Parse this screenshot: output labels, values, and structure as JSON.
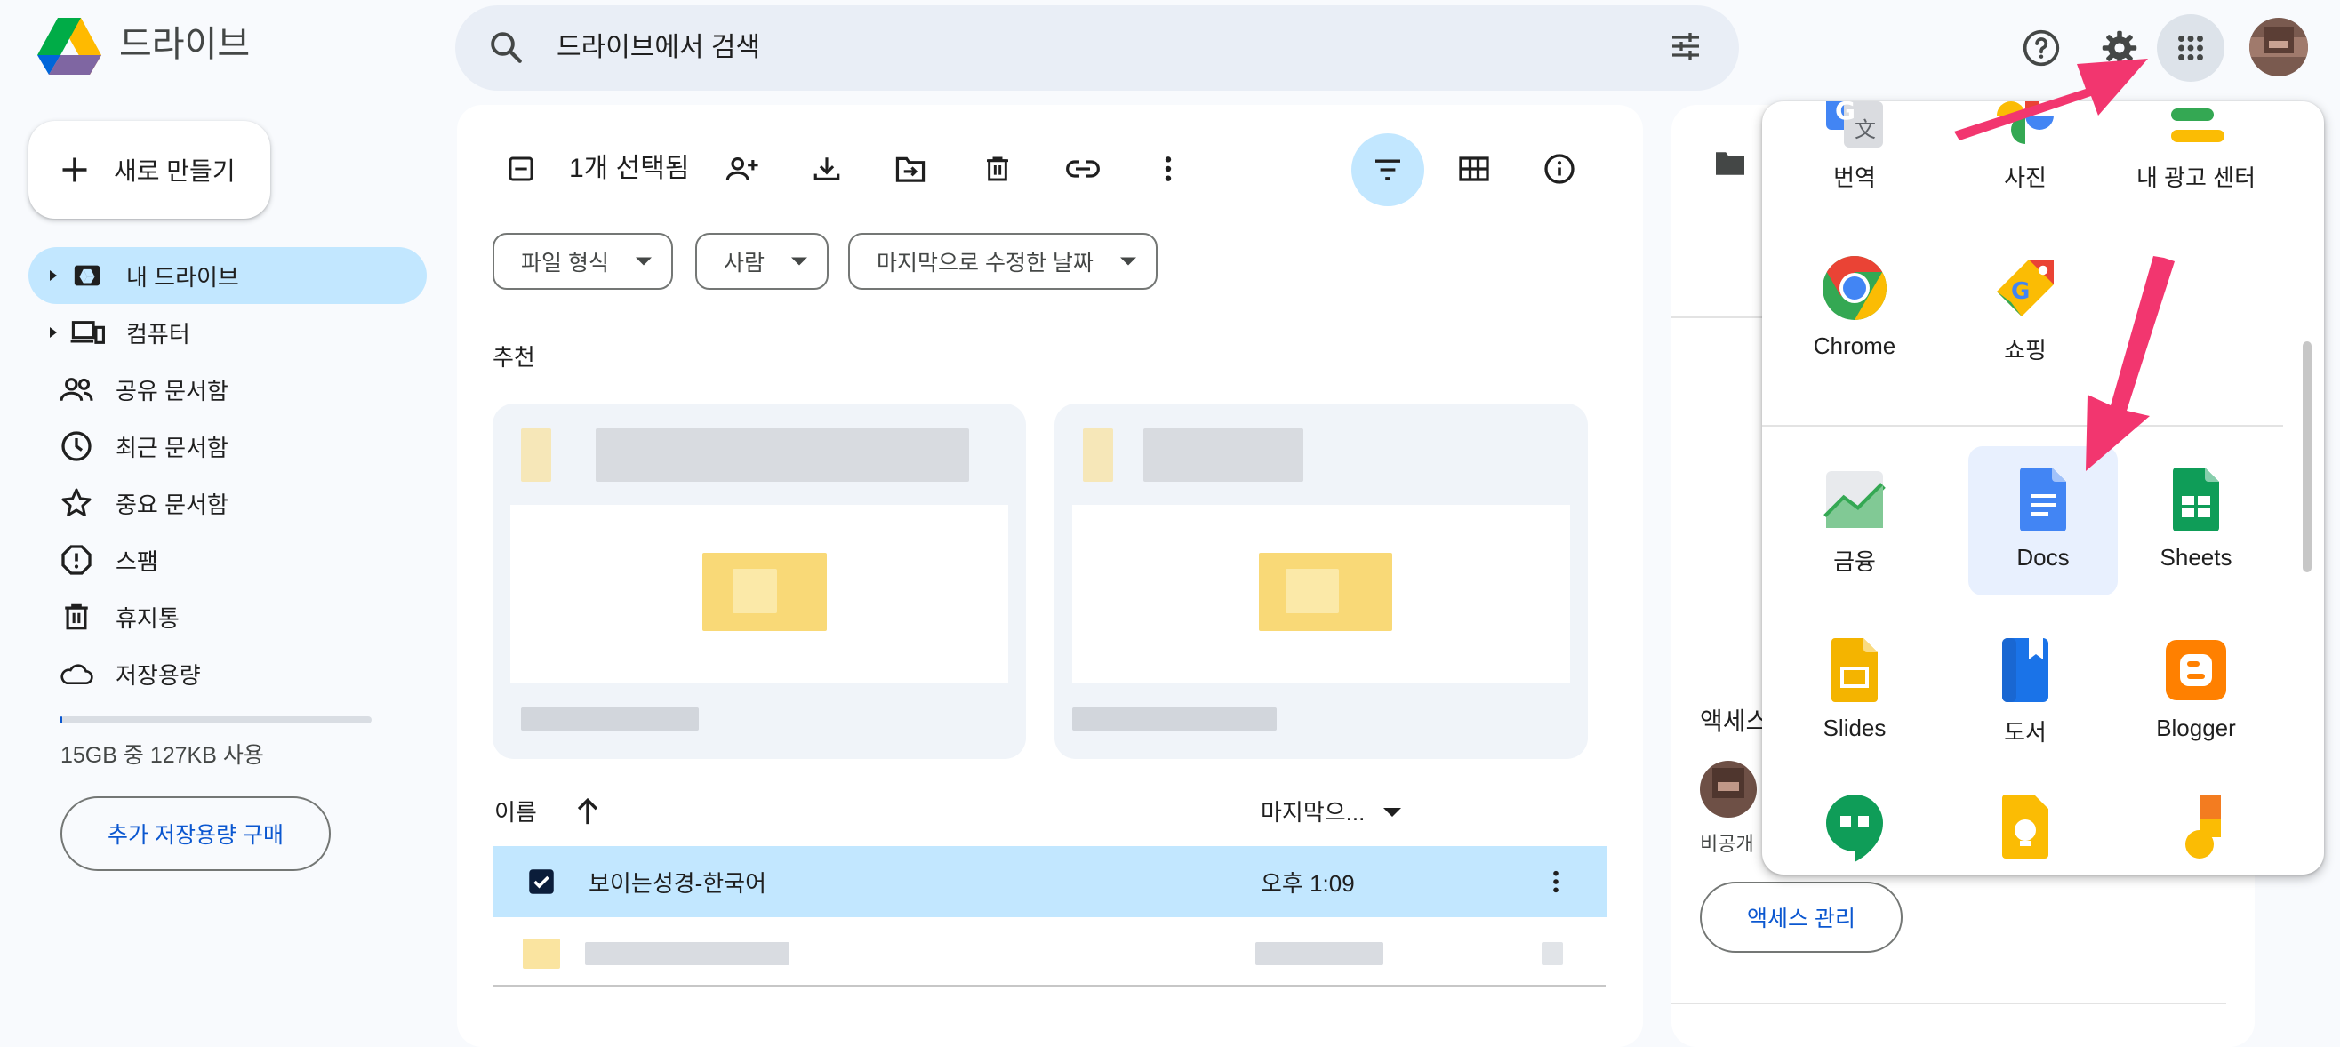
{
  "header": {
    "app_name": "드라이브",
    "search_placeholder": "드라이브에서 검색"
  },
  "sidebar": {
    "new_button": "새로 만들기",
    "items": [
      {
        "label": "내 드라이브",
        "icon": "my-drive-icon",
        "active": true
      },
      {
        "label": "컴퓨터",
        "icon": "computer-icon"
      },
      {
        "label": "공유 문서함",
        "icon": "shared-icon"
      },
      {
        "label": "최근 문서함",
        "icon": "clock-icon"
      },
      {
        "label": "중요 문서함",
        "icon": "star-icon"
      },
      {
        "label": "스팸",
        "icon": "spam-icon"
      },
      {
        "label": "휴지통",
        "icon": "trash-icon"
      },
      {
        "label": "저장용량",
        "icon": "cloud-icon"
      }
    ],
    "storage_used_fraction": 0.0001,
    "storage_text": "15GB 중 127KB 사용",
    "buy_storage": "추가 저장용량 구매"
  },
  "main": {
    "selection_count": "1개 선택됨",
    "filters": [
      "파일 형식",
      "사람",
      "마지막으로 수정한 날짜"
    ],
    "suggested_label": "추천",
    "list": {
      "col_name": "이름",
      "col_modified": "마지막으...",
      "rows": [
        {
          "name": "보이는성경-한국어",
          "modified": "오후 1:09",
          "selected": true
        }
      ]
    }
  },
  "details": {
    "access_label": "액세스",
    "access_private": "비공개",
    "manage_access": "액세스 관리"
  },
  "apps_menu": {
    "apps": [
      {
        "label": "번역",
        "icon": "translate-icon"
      },
      {
        "label": "사진",
        "icon": "photos-icon"
      },
      {
        "label": "내 광고 센터",
        "icon": "ads-center-icon"
      },
      {
        "label": "Chrome",
        "icon": "chrome-icon"
      },
      {
        "label": "쇼핑",
        "icon": "shopping-icon"
      },
      {
        "label": "금융",
        "icon": "finance-icon"
      },
      {
        "label": "Docs",
        "icon": "docs-icon",
        "highlighted": true
      },
      {
        "label": "Sheets",
        "icon": "sheets-icon"
      },
      {
        "label": "Slides",
        "icon": "slides-icon"
      },
      {
        "label": "도서",
        "icon": "books-icon"
      },
      {
        "label": "Blogger",
        "icon": "blogger-icon"
      }
    ]
  },
  "colors": {
    "accent": "#0b57d0",
    "selected_bg": "#c2e7ff",
    "annotation_arrow": "#f2366f"
  }
}
